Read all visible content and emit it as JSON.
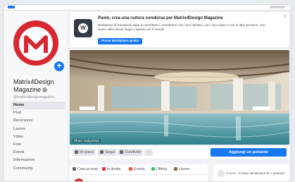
{
  "page": {
    "name": "Matrix4Design Magazine",
    "handle": "@matrix4designmagazine",
    "avatar_letter": "M",
    "avatar_add": "+"
  },
  "nav": [
    {
      "label": "Home",
      "active": true
    },
    {
      "label": "Post"
    },
    {
      "label": "Recensioni"
    },
    {
      "label": "Lavoro"
    },
    {
      "label": "Video"
    },
    {
      "label": "Foto"
    },
    {
      "label": "Eventi"
    },
    {
      "label": "Informazioni"
    },
    {
      "label": "Community"
    }
  ],
  "banner": {
    "icon": "workplace-icon",
    "icon_letter": "W",
    "title": "Paolo, crea una cultura condivisa per Matrix4Design Magazine",
    "text": "Workplace di Facebook aiuta a connettere i contributori con i tuoi obiettivi, con i tuoi valori e con le altre persone, che siano nella stessa luogo o sparse per il mondo.",
    "button": "Prova Workplace gratis",
    "close": "×"
  },
  "cover": {
    "credit": "Photo: Ruby/2021"
  },
  "actions": {
    "like": "Mi piace",
    "follow": "Segui",
    "share": "Condividi",
    "more": "···",
    "cta": "Aggiungi un pulsante"
  },
  "composer": {
    "tabs": [
      "Crea un post",
      "In diretta",
      "Evento",
      "Offerta",
      "Lavoro"
    ]
  },
  "likes": {
    "text": "5 su 5 · in base all'opinione di 1 persona"
  },
  "colors": {
    "brand_red": "#d7282f",
    "facebook_blue": "#1877f2"
  }
}
